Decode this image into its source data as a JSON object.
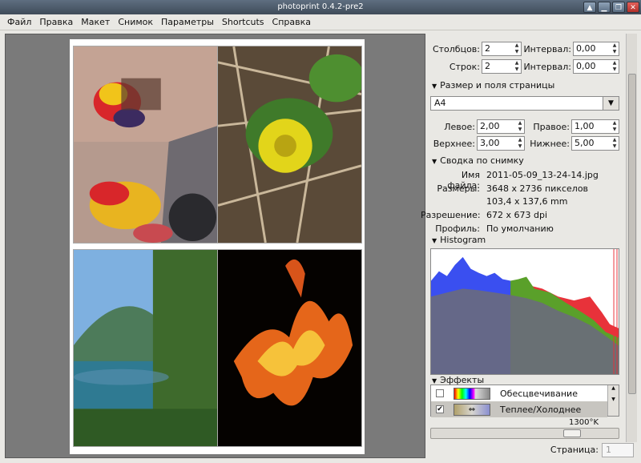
{
  "window": {
    "title": "photoprint 0.4.2-pre2"
  },
  "menu": [
    "Файл",
    "Правка",
    "Макет",
    "Снимок",
    "Параметры",
    "Shortcuts",
    "Справка"
  ],
  "layout": {
    "columns_label": "Столбцов:",
    "columns_value": "2",
    "interval1_label": "Интервал:",
    "interval1_value": "0,00",
    "rows_label": "Строк:",
    "rows_value": "2",
    "interval2_label": "Интервал:",
    "interval2_value": "0,00"
  },
  "page_section": {
    "title": "Размер и поля страницы",
    "paper_size": "A4",
    "left_label": "Левое:",
    "left_value": "2,00",
    "right_label": "Правое:",
    "right_value": "1,00",
    "top_label": "Верхнее:",
    "top_value": "3,00",
    "bottom_label": "Нижнее:",
    "bottom_value": "5,00"
  },
  "summary": {
    "title": "Сводка по снимку",
    "filename_label": "Имя файла:",
    "filename": "2011-05-09_13-24-14.jpg",
    "size_label": "Размеры:",
    "size_px": "3648 x 2736 пикселов",
    "size_mm": "103,4 x 137,6 mm",
    "resolution_label": "Разрешение:",
    "resolution": "672 x 673 dpi",
    "profile_label": "Профиль:",
    "profile": "По умолчанию"
  },
  "histogram": {
    "title": "Histogram",
    "colors": {
      "blue": "#3a4ff0",
      "green": "#5aa02a",
      "red": "#e8323a",
      "gray": "#6a6a7c"
    }
  },
  "effects": {
    "title": "Эффекты",
    "items": [
      {
        "label": "Обесцвечивание",
        "checked": false
      },
      {
        "label": "Теплее/Холоднее",
        "checked": true,
        "mark": "✔"
      }
    ],
    "temperature_label": "1300°K",
    "temperature_level": 0.78
  },
  "status": {
    "page_label": "Страница:",
    "page_value": "1"
  },
  "icons": {
    "minimize": "▁",
    "up": "▲",
    "restore": "❐",
    "close": "✕"
  }
}
